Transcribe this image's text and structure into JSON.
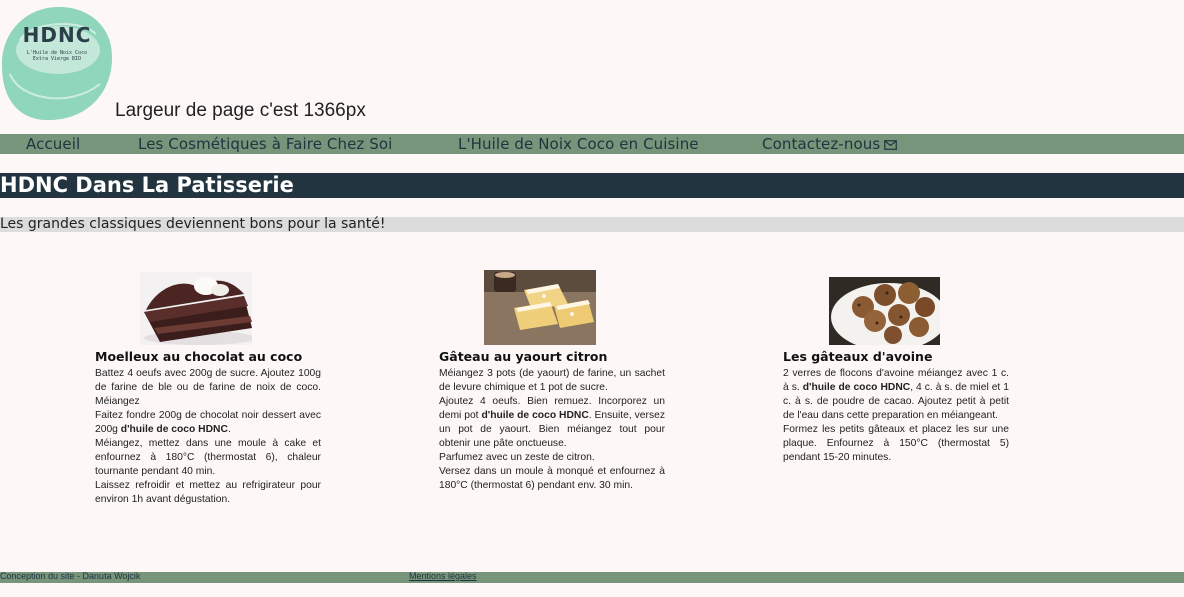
{
  "logo": {
    "text": "HDNC",
    "tagline_line1": "L'Huile de Noix Coco",
    "tagline_line2": "Extra Vierge BIO",
    "color": "#8fd6bd"
  },
  "page_width_note": "Largeur de page c'est 1366px",
  "nav": {
    "items": [
      {
        "label": "Accueil"
      },
      {
        "label": "Les Cosmétiques à Faire Chez Soi"
      },
      {
        "label": "L'Huile de Noix Coco en Cuisine"
      },
      {
        "label": "Contactez-nous"
      }
    ],
    "contact_icon": "envelope-icon",
    "bar_color": "#77957a"
  },
  "page_title": "HDNC Dans La Patisserie",
  "subtitle": "Les grandes classiques deviennent bons pour la santé!",
  "recipes": [
    {
      "title": "Moelleux au chocolat au coco",
      "image": "chocolate-cake-photo",
      "paragraphs": [
        [
          "Battez 4 oeufs avec 200g de sucre. Ajoutez 100g de farine de ble ou de farine de noix de coco. Méiangez"
        ],
        [
          "Faitez fondre 200g de chocolat noir dessert avec 200g ",
          "d'huile de coco HDNC",
          "."
        ],
        [
          "Méiangez, mettez dans une moule à cake et enfournez à 180°C (thermostat 6), chaleur tournante pendant 40 min."
        ],
        [
          "Laissez refroidir et mettez au refrigirateur pour environ 1h avant dégustation."
        ]
      ]
    },
    {
      "title": "Gâteau au yaourt citron",
      "image": "lemon-yogurt-cake-photo",
      "paragraphs": [
        [
          "Méiangez 3 pots (de yaourt) de farine, un sachet de levure chimique et 1 pot de sucre."
        ],
        [
          "Ajoutez 4 oeufs. Bien remuez. Incorporez un demi pot ",
          "d'huile de coco HDNC",
          ". Ensuite, versez un pot de yaourt. Bien méiangez tout pour obtenir une pâte onctueuse."
        ],
        [
          "Parfumez avec un zeste de citron."
        ],
        [
          "Versez dans un moule à monqué et enfournez à 180°C (thermostat 6) pendant env. 30 min."
        ]
      ]
    },
    {
      "title": "Les gâteaux d'avoine",
      "image": "oat-cookies-photo",
      "paragraphs": [
        [
          "2 verres de flocons d'avoine méiangez avec 1 c. à s. ",
          "d'huile de coco HDNC",
          ", 4 c. à s. de miel et 1 c. à s. de poudre de cacao. Ajoutez petit à petit de l'eau dans cette preparation en méiangeant."
        ],
        [
          "Formez les petits gâteaux et placez les sur une plaque. Enfournez à 150°C (thermostat 5) pendant 15-20 minutes."
        ]
      ]
    }
  ],
  "footer": {
    "credit": "Conception du site - Danuta Wojcik",
    "legal_link": "Mentions légales"
  }
}
